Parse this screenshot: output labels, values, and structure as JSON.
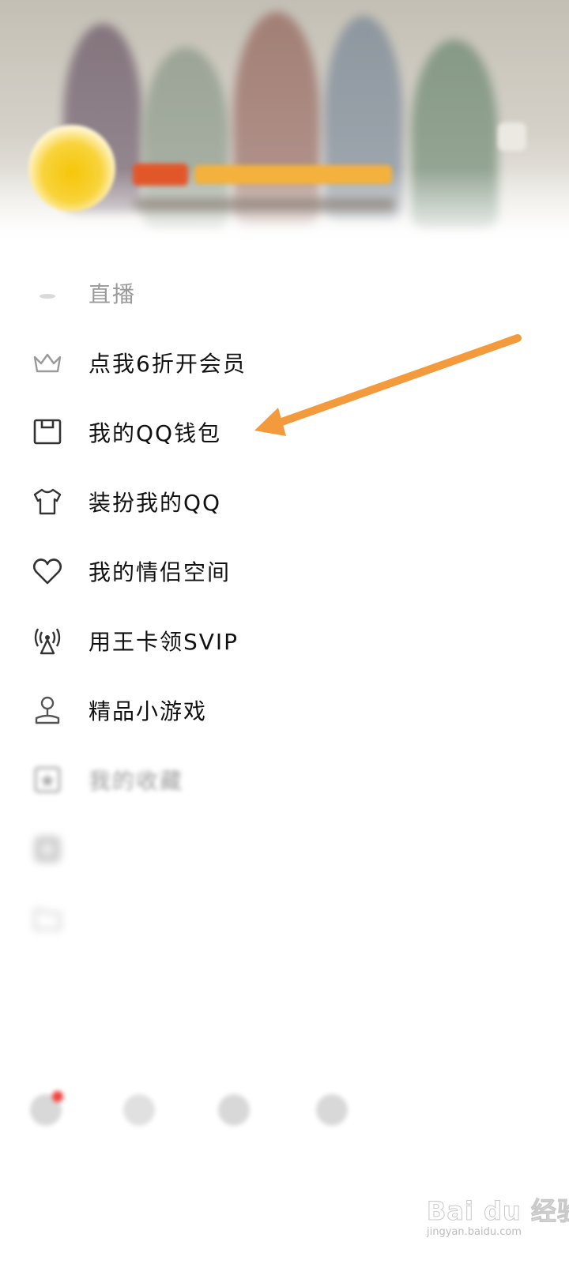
{
  "header": {
    "nickname": "",
    "signature": ""
  },
  "menu": {
    "items": [
      {
        "key": "live",
        "label": "直播",
        "icon": "live-icon",
        "style": "faded"
      },
      {
        "key": "vip",
        "label": "点我6折开会员",
        "icon": "crown-icon",
        "style": "normal"
      },
      {
        "key": "wallet",
        "label": "我的QQ钱包",
        "icon": "wallet-icon",
        "style": "normal"
      },
      {
        "key": "dressup",
        "label": "装扮我的QQ",
        "icon": "shirt-icon",
        "style": "normal"
      },
      {
        "key": "couple",
        "label": "我的情侣空间",
        "icon": "heart-icon",
        "style": "normal"
      },
      {
        "key": "kingcard",
        "label": "用王卡领SVIP",
        "icon": "signal-tower-icon",
        "style": "normal"
      },
      {
        "key": "games",
        "label": "精品小游戏",
        "icon": "joystick-icon",
        "style": "normal"
      },
      {
        "key": "favorites",
        "label": "我的收藏",
        "icon": "star-box-icon",
        "style": "blurred"
      },
      {
        "key": "album",
        "label": "",
        "icon": "album-icon",
        "style": "blurred2"
      },
      {
        "key": "files",
        "label": "",
        "icon": "folder-icon",
        "style": "blurred2"
      }
    ]
  },
  "annotation": {
    "arrow_color": "#f39a3d"
  },
  "bottom_bar": {
    "tabs": [
      {
        "label": "",
        "icon": "settings-icon",
        "badge": true
      },
      {
        "label": "",
        "icon": "phone-icon",
        "badge": false
      },
      {
        "label": "",
        "icon": "theme-icon",
        "badge": false
      },
      {
        "label": "",
        "icon": "weather-icon",
        "badge": false
      }
    ]
  },
  "watermark": {
    "brand": "Bai du 经验",
    "url": "jingyan.baidu.com"
  }
}
